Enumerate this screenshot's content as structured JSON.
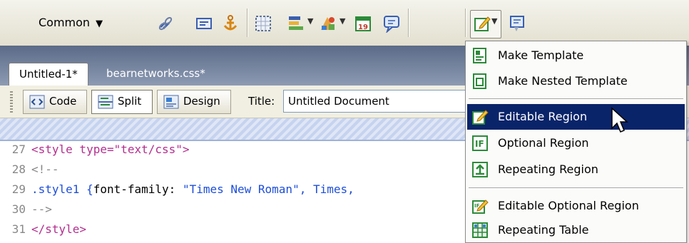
{
  "insert_bar": {
    "category": "Common",
    "icons": [
      "hyperlink-icon",
      "email-link-icon",
      "named-anchor-icon",
      "table-icon",
      "layer-icon",
      "images-icon",
      "media-icon",
      "date-icon",
      "comment-icon",
      "templates-icon",
      "tag-chooser-icon"
    ]
  },
  "document": {
    "tabs": [
      "Untitled-1*",
      "bearnetworks.css*"
    ],
    "views": {
      "code": "Code",
      "split": "Split",
      "design": "Design"
    },
    "title_label": "Title:",
    "title_value": "Untitled Document"
  },
  "code_lines": [
    {
      "num": "27",
      "text": "<style type=\"text/css\">"
    },
    {
      "num": "28",
      "text": "<!--"
    },
    {
      "num": "29",
      "sel": ".style1 {",
      "prop": "font-family: ",
      "val": "\"Times New Roman\", Times,"
    },
    {
      "num": "30",
      "text": "-->"
    },
    {
      "num": "31",
      "text": "</style>"
    }
  ],
  "template_menu": {
    "items": [
      {
        "label": "Make Template"
      },
      {
        "label": "Make Nested Template"
      },
      {
        "label": "Editable Region"
      },
      {
        "label": "Optional Region"
      },
      {
        "label": "Repeating Region"
      },
      {
        "label": "Editable Optional Region"
      },
      {
        "label": "Repeating Table"
      }
    ],
    "selected_label": "Editable Region"
  },
  "colors": {
    "menu_highlight": "#0a246a",
    "tag": "#b22f8e",
    "selector": "#1d4ed8"
  }
}
